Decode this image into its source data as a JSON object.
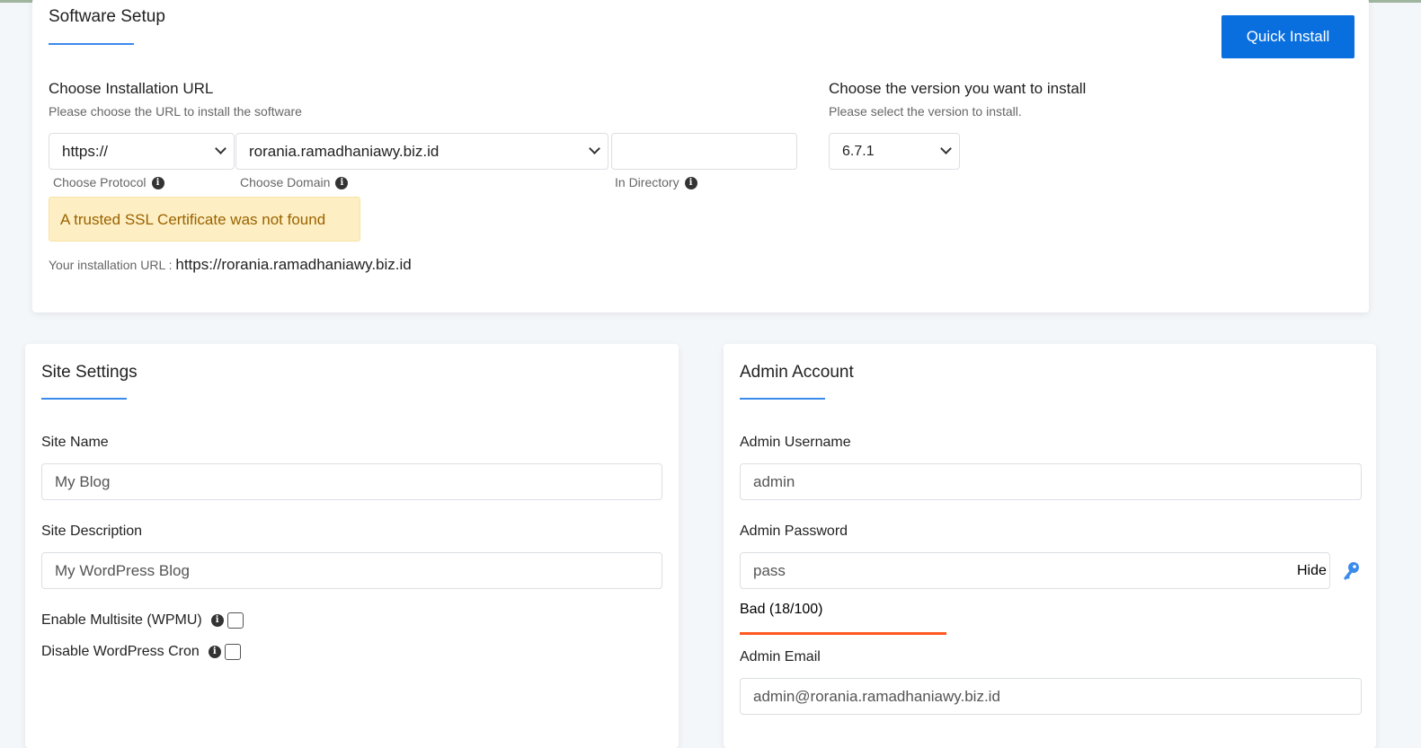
{
  "software_setup": {
    "title": "Software Setup",
    "quick_install": "Quick Install",
    "url_heading": "Choose Installation URL",
    "url_sub": "Please choose the URL to install the software",
    "protocol": "https://",
    "domain": "rorania.ramadhaniawy.biz.id",
    "directory": "",
    "protocol_label": "Choose Protocol",
    "domain_label": "Choose Domain",
    "directory_label": "In Directory",
    "ssl_warning": "A trusted SSL Certificate was not found",
    "install_url_label": "Your installation URL :",
    "install_url": "https://rorania.ramadhaniawy.biz.id",
    "version_heading": "Choose the version you want to install",
    "version_sub": "Please select the version to install.",
    "version": "6.7.1"
  },
  "site_settings": {
    "title": "Site Settings",
    "site_name_label": "Site Name",
    "site_name": "My Blog",
    "site_desc_label": "Site Description",
    "site_desc": "My WordPress Blog",
    "multisite_label": "Enable Multisite (WPMU)",
    "multisite_checked": false,
    "cron_label": "Disable WordPress Cron",
    "cron_checked": false
  },
  "admin_account": {
    "title": "Admin Account",
    "username_label": "Admin Username",
    "username": "admin",
    "password_label": "Admin Password",
    "password": "pass",
    "hide_label": "Hide",
    "strength_text": "Bad (18/100)",
    "strength_value": 18,
    "strength_color": "#ff5722",
    "email_label": "Admin Email",
    "email": "admin@rorania.ramadhaniawy.biz.id"
  },
  "colors": {
    "accent": "#0a6fde",
    "warning_bg": "#fdefc3",
    "warning_text": "#9a6200"
  }
}
